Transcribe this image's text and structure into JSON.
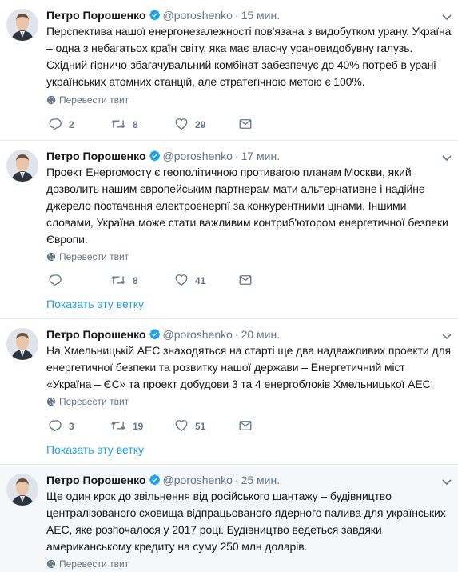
{
  "tweets": [
    {
      "author": "Петро Порошенко",
      "handle": "@poroshenko",
      "separator": "·",
      "time": "15 мин.",
      "text": "Перспектива нашої енергонезалежності пов'язана з видобутком урану. Україна – одна з небагатьох країн світу, яка має власну урановидобувну галузь. Східний гірничо-збагачувальний комбінат забезпечує до 40% потреб в урані українських атомних станцій, але стратегічною метою є 100%.",
      "translate_label": "Перевести твит",
      "replies": "2",
      "retweets": "8",
      "likes": "29"
    },
    {
      "author": "Петро Порошенко",
      "handle": "@poroshenko",
      "separator": "·",
      "time": "17 мин.",
      "text": "Проект Енергомосту є геополітичною противагою планам Москви, який дозволить нашим європейським партнерам мати альтернативне і надійне джерело постачання електроенергії за конкурентними цінами. Іншими словами, Україна може стати важливим контриб'ютором енергетичної безпеки Європи.",
      "translate_label": "Перевести твит",
      "replies": "",
      "retweets": "8",
      "likes": "41",
      "thread_link": "Показать эту ветку"
    },
    {
      "author": "Петро Порошенко",
      "handle": "@poroshenko",
      "separator": "·",
      "time": "20 мин.",
      "text": "На Хмельницькій АЕС знаходяться на старті ще два надважливих проекти для енергетичної безпеки та розвитку нашої держави – Енергетичний міст «Україна – ЄС» та проект добудови 3 та 4 енергоблоків Хмельницької АЕС.",
      "translate_label": "Перевести твит",
      "replies": "3",
      "retweets": "19",
      "likes": "51",
      "thread_link": "Показать эту ветку"
    },
    {
      "author": "Петро Порошенко",
      "handle": "@poroshenko",
      "separator": "·",
      "time": "25 мин.",
      "text": "Ще один крок до звільнення від російського шантажу – будівництво централізованого сховища відпрацьованого ядерного палива для українських АЕС, яке розпочалося у 2017 році. Будівництво ведеться завдяки американському кредиту на суму 250 млн доларів.",
      "translate_label": "Перевести твит"
    }
  ],
  "icons": {
    "verified": "verified-badge-icon",
    "caret": "chevron-down-icon",
    "globe": "globe-icon",
    "reply": "reply-icon",
    "retweet": "retweet-icon",
    "like": "heart-icon",
    "dm": "direct-message-icon"
  },
  "colors": {
    "accent": "#1da1f2",
    "muted": "#657786",
    "text": "#14171a",
    "divider": "#e6ecf0",
    "shaded_bg": "#f5f8fa"
  }
}
